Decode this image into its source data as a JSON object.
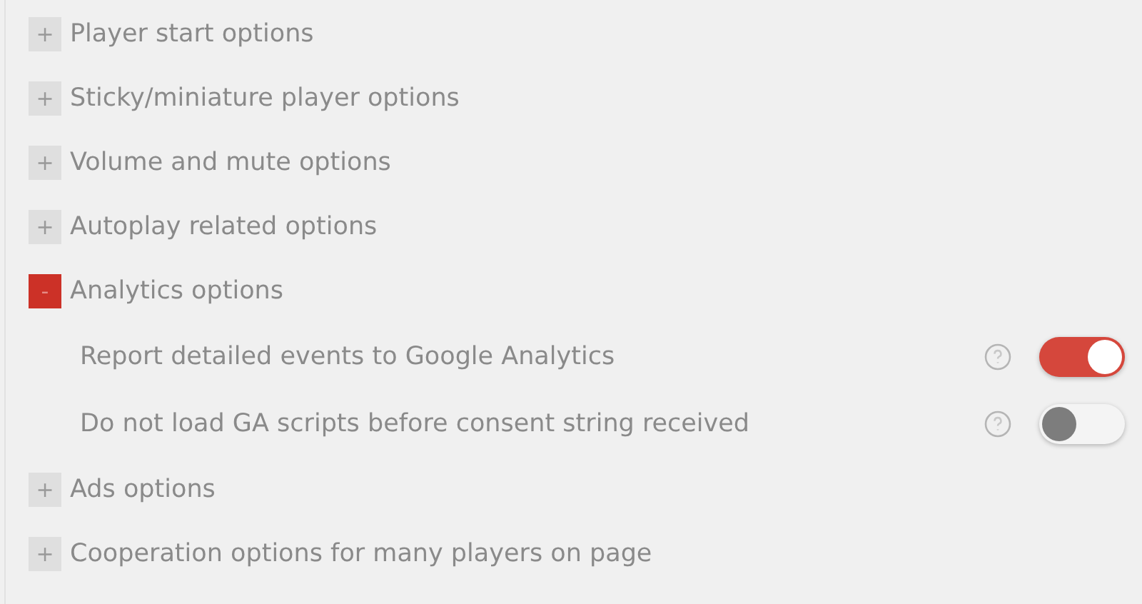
{
  "sections": [
    {
      "symbol": "+",
      "title": "Player start options",
      "expanded": false
    },
    {
      "symbol": "+",
      "title": "Sticky/miniature player options",
      "expanded": false
    },
    {
      "symbol": "+",
      "title": "Volume and mute options",
      "expanded": false
    },
    {
      "symbol": "+",
      "title": "Autoplay related options",
      "expanded": false
    },
    {
      "symbol": "-",
      "title": "Analytics options",
      "expanded": true,
      "settings": [
        {
          "label": "Report detailed events to Google Analytics",
          "on": true
        },
        {
          "label": "Do not load GA scripts before consent string received",
          "on": false
        }
      ]
    },
    {
      "symbol": "+",
      "title": "Ads options",
      "expanded": false
    },
    {
      "symbol": "+",
      "title": "Cooperation options for many players on page",
      "expanded": false
    }
  ]
}
